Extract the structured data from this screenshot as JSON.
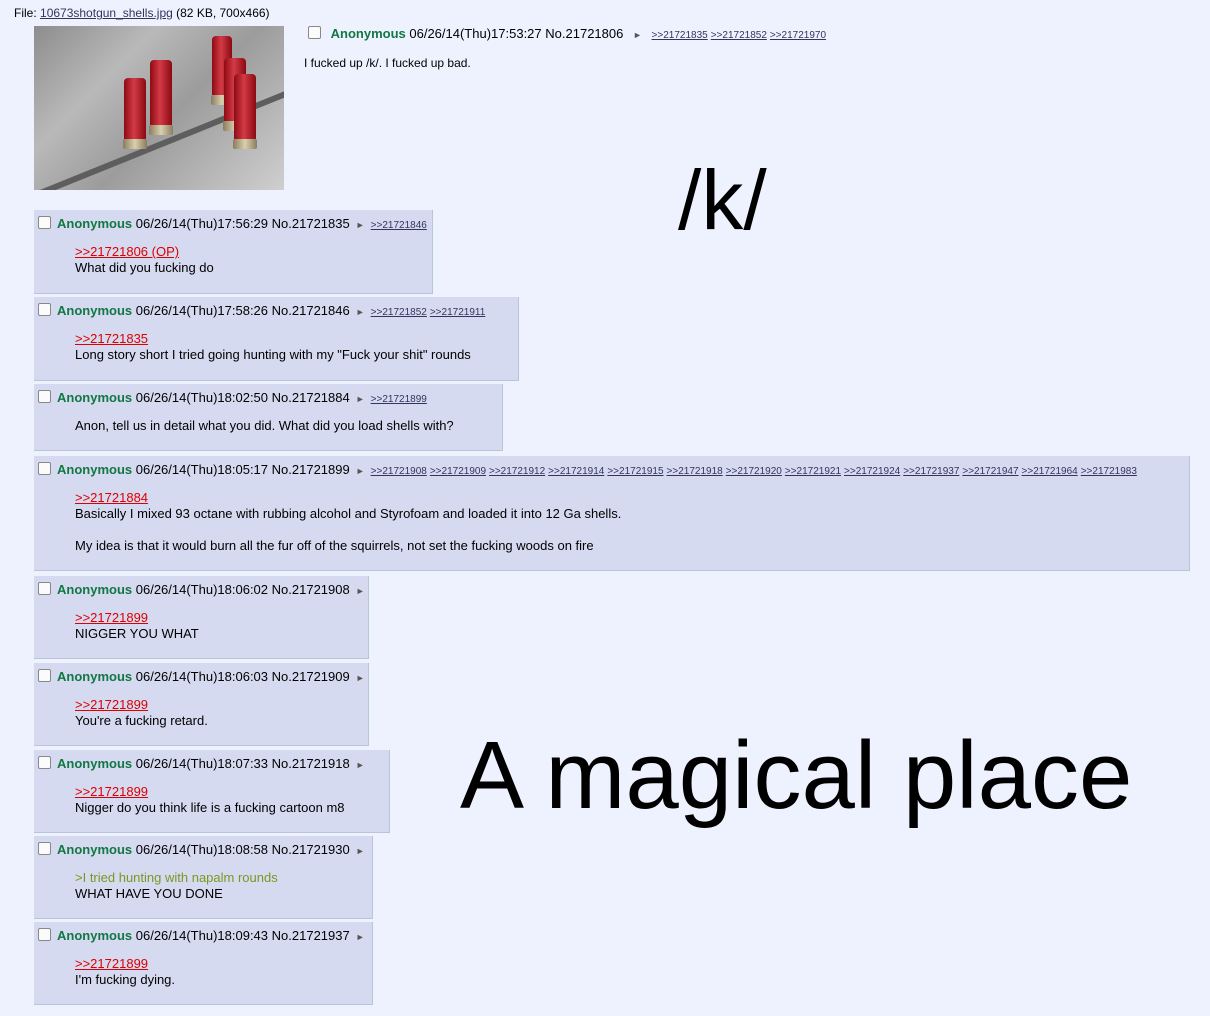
{
  "file": {
    "label": "File:",
    "name": "10673shotgun_shells.jpg",
    "meta": "(82 KB, 700x466)"
  },
  "op": {
    "name": "Anonymous",
    "datetime": "06/26/14(Thu)17:53:27",
    "number": "No.21721806",
    "arrow": "►",
    "backlinks": [
      ">>21721835",
      ">>21721852",
      ">>21721970"
    ],
    "comment": "I fucked up /k/. I fucked up bad."
  },
  "posts": [
    {
      "name": "Anonymous",
      "datetime": "06/26/14(Thu)17:56:29",
      "number": "No.21721835",
      "backlinks": [
        ">>21721846"
      ],
      "quote": ">>21721806 (OP)",
      "lines": [
        "What did you fucking do"
      ]
    },
    {
      "name": "Anonymous",
      "datetime": "06/26/14(Thu)17:58:26",
      "number": "No.21721846",
      "backlinks": [
        ">>21721852",
        ">>21721911"
      ],
      "quote": ">>21721835",
      "lines": [
        "Long story short I tried going hunting with my \"Fuck your shit\" rounds"
      ]
    },
    {
      "name": "Anonymous",
      "datetime": "06/26/14(Thu)18:02:50",
      "number": "No.21721884",
      "backlinks": [
        ">>21721899"
      ],
      "quote": "",
      "lines": [
        "Anon, tell us in detail what you did. What did you load shells with?"
      ]
    },
    {
      "name": "Anonymous",
      "datetime": "06/26/14(Thu)18:05:17",
      "number": "No.21721899",
      "backlinks": [
        ">>21721908",
        ">>21721909",
        ">>21721912",
        ">>21721914",
        ">>21721915",
        ">>21721918",
        ">>21721920",
        ">>21721921",
        ">>21721924",
        ">>21721937",
        ">>21721947",
        ">>21721964",
        ">>21721983"
      ],
      "quote": ">>21721884",
      "lines": [
        "Basically I mixed 93 octane with rubbing alcohol and Styrofoam and loaded it into 12 Ga shells.",
        "",
        "My idea is that it would burn all the fur off of the squirrels, not set the fucking woods on fire"
      ]
    },
    {
      "name": "Anonymous",
      "datetime": "06/26/14(Thu)18:06:02",
      "number": "No.21721908",
      "backlinks": [],
      "quote": ">>21721899",
      "lines": [
        "NIGGER YOU WHAT"
      ]
    },
    {
      "name": "Anonymous",
      "datetime": "06/26/14(Thu)18:06:03",
      "number": "No.21721909",
      "backlinks": [],
      "quote": ">>21721899",
      "lines": [
        "You're a fucking retard."
      ]
    },
    {
      "name": "Anonymous",
      "datetime": "06/26/14(Thu)18:07:33",
      "number": "No.21721918",
      "backlinks": [],
      "quote": ">>21721899",
      "lines": [
        "Nigger do you think life is a fucking cartoon m8"
      ]
    },
    {
      "name": "Anonymous",
      "datetime": "06/26/14(Thu)18:08:58",
      "number": "No.21721930",
      "backlinks": [],
      "greentext": ">I tried hunting with napalm rounds",
      "quote": "",
      "lines": [
        "WHAT HAVE YOU DONE"
      ]
    },
    {
      "name": "Anonymous",
      "datetime": "06/26/14(Thu)18:09:43",
      "number": "No.21721937",
      "backlinks": [],
      "quote": ">>21721899",
      "lines": [
        "I'm fucking dying."
      ]
    }
  ],
  "overlay": {
    "board": "/k/",
    "caption": "A magical place"
  },
  "colors": {
    "background": "#eef2ff",
    "post_bg": "#d6daf0",
    "name": "#117743",
    "quotelink": "#dd0000",
    "greentext": "#789922"
  }
}
